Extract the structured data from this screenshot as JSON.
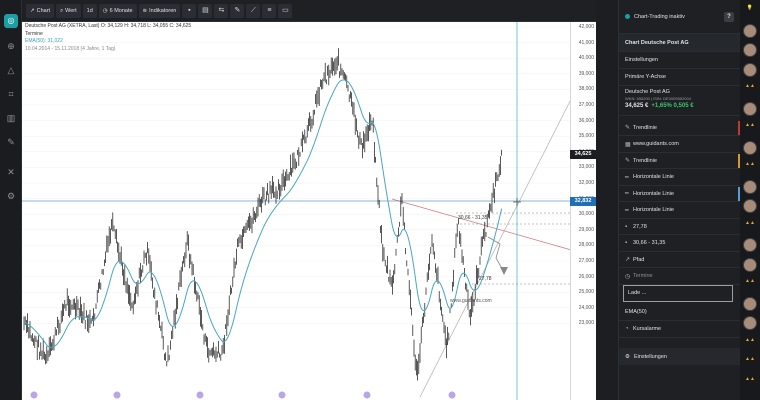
{
  "toolbar": {
    "chart_label": "Chart",
    "wert_label": "Wert",
    "interval_label": "1d",
    "range_label": "6 Monate",
    "indicators_label": "Indikatoren"
  },
  "chart": {
    "instrument_line": "Deutsche Post AG (XETRA, Last) O: 34,129  H: 34,718  L: 34,055  C: 34,625",
    "termine_label": "Termine",
    "ema_label": "EMA(50): 31,022",
    "range_info": "10.04.2014 - 15.11.2018 (4 Jahre, 1 Tag)",
    "annotation_range": "30,66 - 31,35",
    "annotation_level": "27,78",
    "watermark": "www.guidants.com",
    "last_price_tag": "34,625",
    "crosshair_tag": "32,832",
    "y_ticks": [
      "42,000",
      "41,000",
      "40,000",
      "39,000",
      "38,000",
      "37,000",
      "36,000",
      "35,000",
      "34,000",
      "33,000",
      "32,000",
      "31,000",
      "30,000",
      "29,000",
      "28,000",
      "27,000",
      "26,000",
      "25,000",
      "24,000",
      "23,000"
    ]
  },
  "panel": {
    "header": "Chart-Trading inaktiv",
    "help": "?",
    "title": "Chart Deutsche Post AG",
    "settings": "Einstellungen",
    "primary_axis": "Primäre Y-Achse",
    "stock_name": "Deutsche Post AG",
    "stock_meta": "WKN: 555200 | ISIN: DE0005552004",
    "stock_price": "34,625 €",
    "stock_change": "+1,65%  0,505 €",
    "items": [
      "Trendlinie",
      "www.guidants.com",
      "Trendlinie",
      "Horizontale Linie",
      "Horizontale Linie",
      "Horizontale Linie",
      "27,78",
      "30,66 - 31,35",
      "Pfad",
      "Termine"
    ],
    "loading": "Lade ...",
    "ema_item": "EMA(50)",
    "kursalarme": "Kursalarme",
    "footer": "Einstellungen"
  },
  "colors": {
    "accent": "#1a9fa3",
    "ema": "#3a9fc0",
    "positive": "#3cc46a",
    "price_tag": "#1b1d21",
    "crosshair_tag": "#1e6fb5"
  }
}
